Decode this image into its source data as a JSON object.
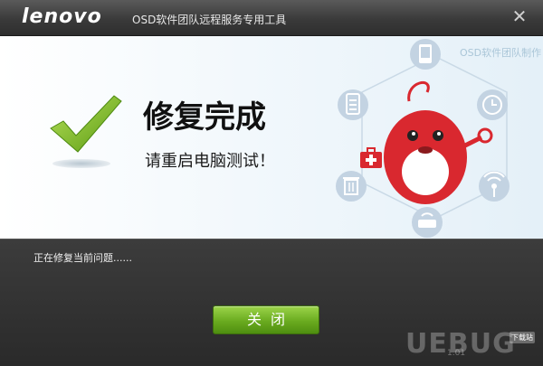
{
  "titlebar": {
    "logo": "lenovo",
    "title": "OSD软件团队远程服务专用工具",
    "close_icon": "close-icon"
  },
  "banner": {
    "watermark": "OSD软件团队制作",
    "heading": "修复完成",
    "subheading": "请重启电脑测试！",
    "icons": [
      "tablet-icon",
      "clipboard-icon",
      "clock-icon",
      "first-aid-kit-icon",
      "trash-icon",
      "signal-icon",
      "router-icon"
    ]
  },
  "footer": {
    "status": "正在修复当前问题......",
    "close_button": "关闭",
    "watermark": "UEBUG",
    "watermark_sub": "1.01",
    "download_badge": "下载站"
  },
  "colors": {
    "accent_green": "#6aab1f",
    "mascot_red": "#d9282f"
  }
}
